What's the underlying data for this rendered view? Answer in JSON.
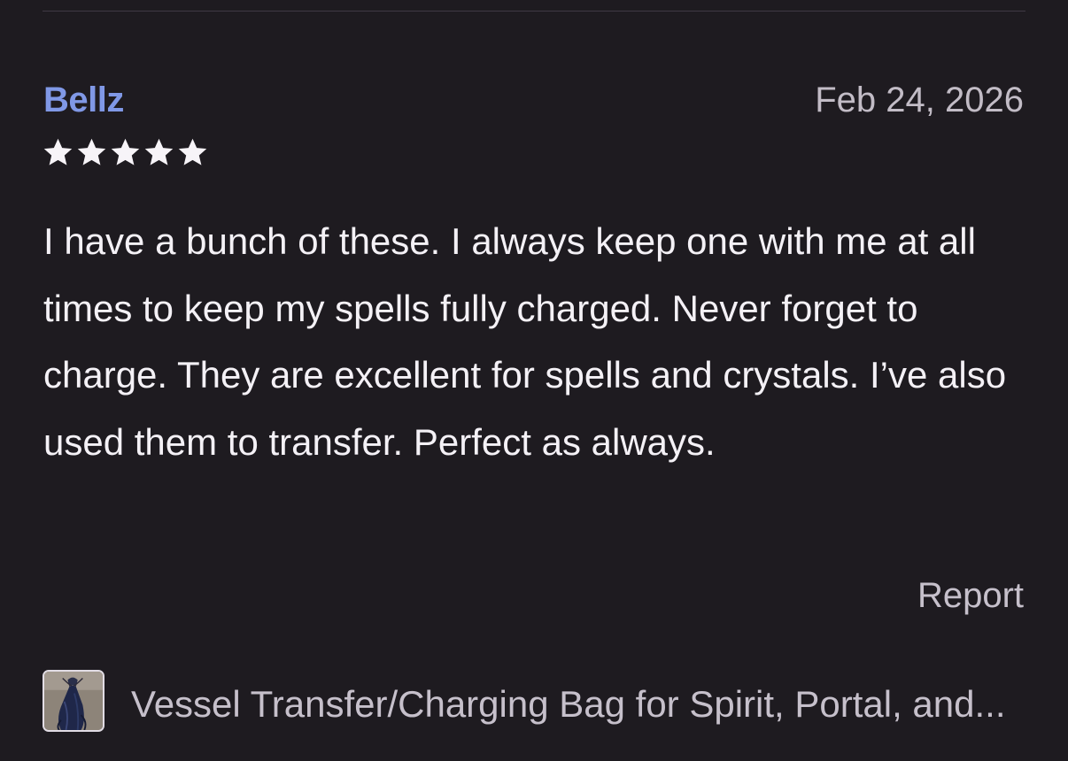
{
  "review": {
    "reviewer_name": "Bellz",
    "date": "Feb 24, 2026",
    "rating": 5,
    "rating_max": 5,
    "text": "I have a bunch of these. I always keep one with me at all times to keep my spells fully charged. Never forget to charge. They are excellent for spells and crystals. I’ve also used them to transfer. Perfect as always.",
    "report_label": "Report"
  },
  "product": {
    "title": "Vessel Transfer/Charging Bag for Spirit, Portal, and...",
    "thumbnail_icon": "velvet-drawstring-bag-image"
  },
  "colors": {
    "background": "#1e1b20",
    "reviewer_name": "#8098e6",
    "secondary_text": "#c6c0cb",
    "primary_text": "#f4f1f6",
    "star": "#f7f4f8"
  }
}
